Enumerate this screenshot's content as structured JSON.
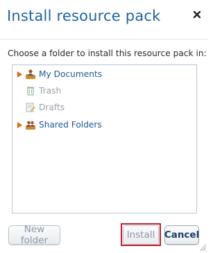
{
  "dialog": {
    "title": "Install resource pack",
    "close_icon": "close-icon",
    "prompt": "Choose a folder to install this resource pack in:"
  },
  "tree": {
    "items": [
      {
        "label": "My Documents",
        "icon": "user-folder-icon",
        "expandable": true,
        "enabled": true
      },
      {
        "label": "Trash",
        "icon": "trash-icon",
        "expandable": false,
        "enabled": false
      },
      {
        "label": "Drafts",
        "icon": "drafts-icon",
        "expandable": false,
        "enabled": false
      },
      {
        "label": "Shared Folders",
        "icon": "shared-folder-icon",
        "expandable": true,
        "enabled": true
      }
    ]
  },
  "buttons": {
    "new_folder": "New folder",
    "install": "Install",
    "cancel": "Cancel"
  },
  "colors": {
    "title": "#1f63a3",
    "link": "#1c5b95",
    "disabled": "#9aa0a6",
    "expand_arrow": "#e0661c",
    "highlight": "#c01d2e"
  }
}
